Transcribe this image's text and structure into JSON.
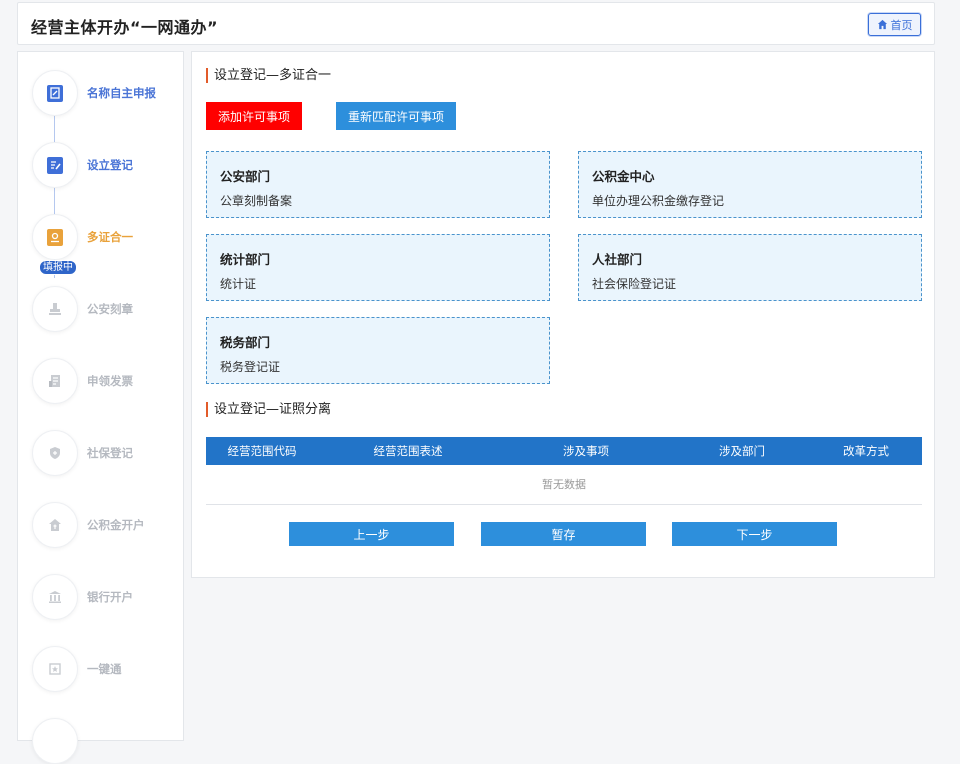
{
  "header": {
    "title": "经营主体开办“一网通办”",
    "home_label": "首页"
  },
  "sidebar": {
    "badge": "填报中",
    "steps": [
      {
        "label": "名称自主申报",
        "state": "done",
        "icon": "edit-document-icon"
      },
      {
        "label": "设立登记",
        "state": "done",
        "icon": "pen-document-icon"
      },
      {
        "label": "多证合一",
        "state": "active",
        "icon": "certificate-icon"
      },
      {
        "label": "公安刻章",
        "state": "todo",
        "icon": "stamp-icon"
      },
      {
        "label": "申领发票",
        "state": "todo",
        "icon": "invoice-icon"
      },
      {
        "label": "社保登记",
        "state": "todo",
        "icon": "shield-icon"
      },
      {
        "label": "公积金开户",
        "state": "todo",
        "icon": "house-fund-icon"
      },
      {
        "label": "银行开户",
        "state": "todo",
        "icon": "bank-icon"
      },
      {
        "label": "一键通",
        "state": "todo",
        "icon": "star-badge-icon"
      }
    ]
  },
  "main": {
    "section1_title": "设立登记—多证合一",
    "add_button": "添加许可事项",
    "rematch_button": "重新匹配许可事项",
    "cards": [
      {
        "title": "公安部门",
        "desc": "公章刻制备案"
      },
      {
        "title": "公积金中心",
        "desc": "单位办理公积金缴存登记"
      },
      {
        "title": "统计部门",
        "desc": "统计证"
      },
      {
        "title": "人社部门",
        "desc": "社会保险登记证"
      },
      {
        "title": "税务部门",
        "desc": "税务登记证"
      }
    ],
    "section2_title": "设立登记—证照分离",
    "table": {
      "headers": [
        "经营范围代码",
        "经营范围表述",
        "涉及事项",
        "涉及部门",
        "改革方式"
      ],
      "empty_text": "暂无数据"
    },
    "prev_button": "上一步",
    "save_button": "暂存",
    "next_button": "下一步"
  },
  "colors": {
    "primary": "#2d8fdc",
    "table_header": "#2274c8",
    "add_button": "#ff0000",
    "active_step": "#e9a23b",
    "done_step": "#4a74d6"
  }
}
